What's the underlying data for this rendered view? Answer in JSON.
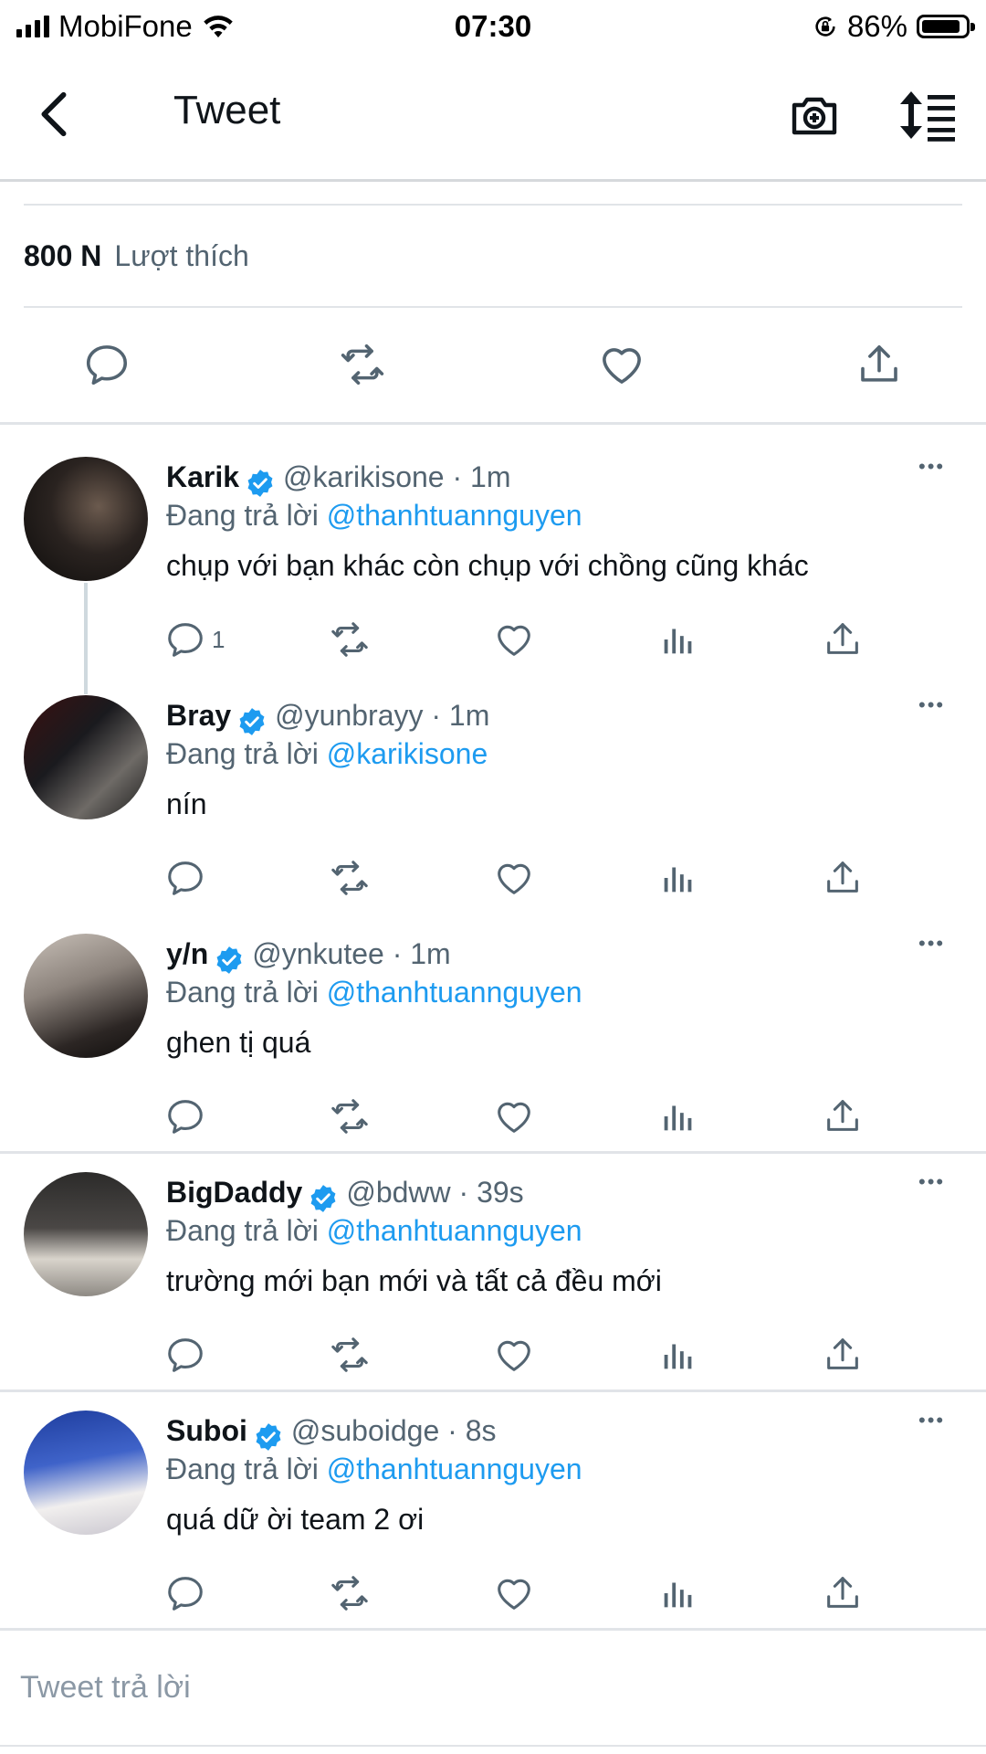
{
  "status_bar": {
    "carrier": "MobiFone",
    "time": "07:30",
    "battery_percent": "86%",
    "battery_level": 0.86
  },
  "header": {
    "title": "Tweet",
    "back_icon": "chevron-left-icon",
    "camera_icon": "camera-add-icon",
    "sort_icon": "sort-icon"
  },
  "stats": {
    "likes_count": "800 N",
    "likes_label": "Lượt thích"
  },
  "colors": {
    "accent": "#1d9bf0",
    "muted_text": "#536471",
    "divider": "#e1e4e8",
    "icon": "#536471"
  },
  "replies": [
    {
      "name": "Karik",
      "handle": "@karikisone",
      "time": "1m",
      "replying_label": "Đang trả lời",
      "replying_to": "@thanhtuannguyen",
      "text": "chụp với bạn khác còn chụp với chồng cũng khác",
      "reply_count": "1"
    },
    {
      "name": "Bray",
      "handle": "@yunbrayy",
      "time": "1m",
      "replying_label": "Đang trả lời",
      "replying_to": "@karikisone",
      "text": "nín",
      "reply_count": ""
    },
    {
      "name": "y/n",
      "handle": "@ynkutee",
      "time": "1m",
      "replying_label": "Đang trả lời",
      "replying_to": "@thanhtuannguyen",
      "text": "ghen tị quá",
      "reply_count": ""
    },
    {
      "name": "BigDaddy",
      "handle": "@bdww",
      "time": "39s",
      "replying_label": "Đang trả lời",
      "replying_to": "@thanhtuannguyen",
      "text": "trường mới bạn mới và tất cả đều mới",
      "reply_count": ""
    },
    {
      "name": "Suboi",
      "handle": "@suboidge",
      "time": "8s",
      "replying_label": "Đang trả lời",
      "replying_to": "@thanhtuannguyen",
      "text": "quá dữ ời team 2 ơi",
      "reply_count": ""
    }
  ],
  "reply_input": {
    "placeholder": "Tweet trả lời"
  }
}
